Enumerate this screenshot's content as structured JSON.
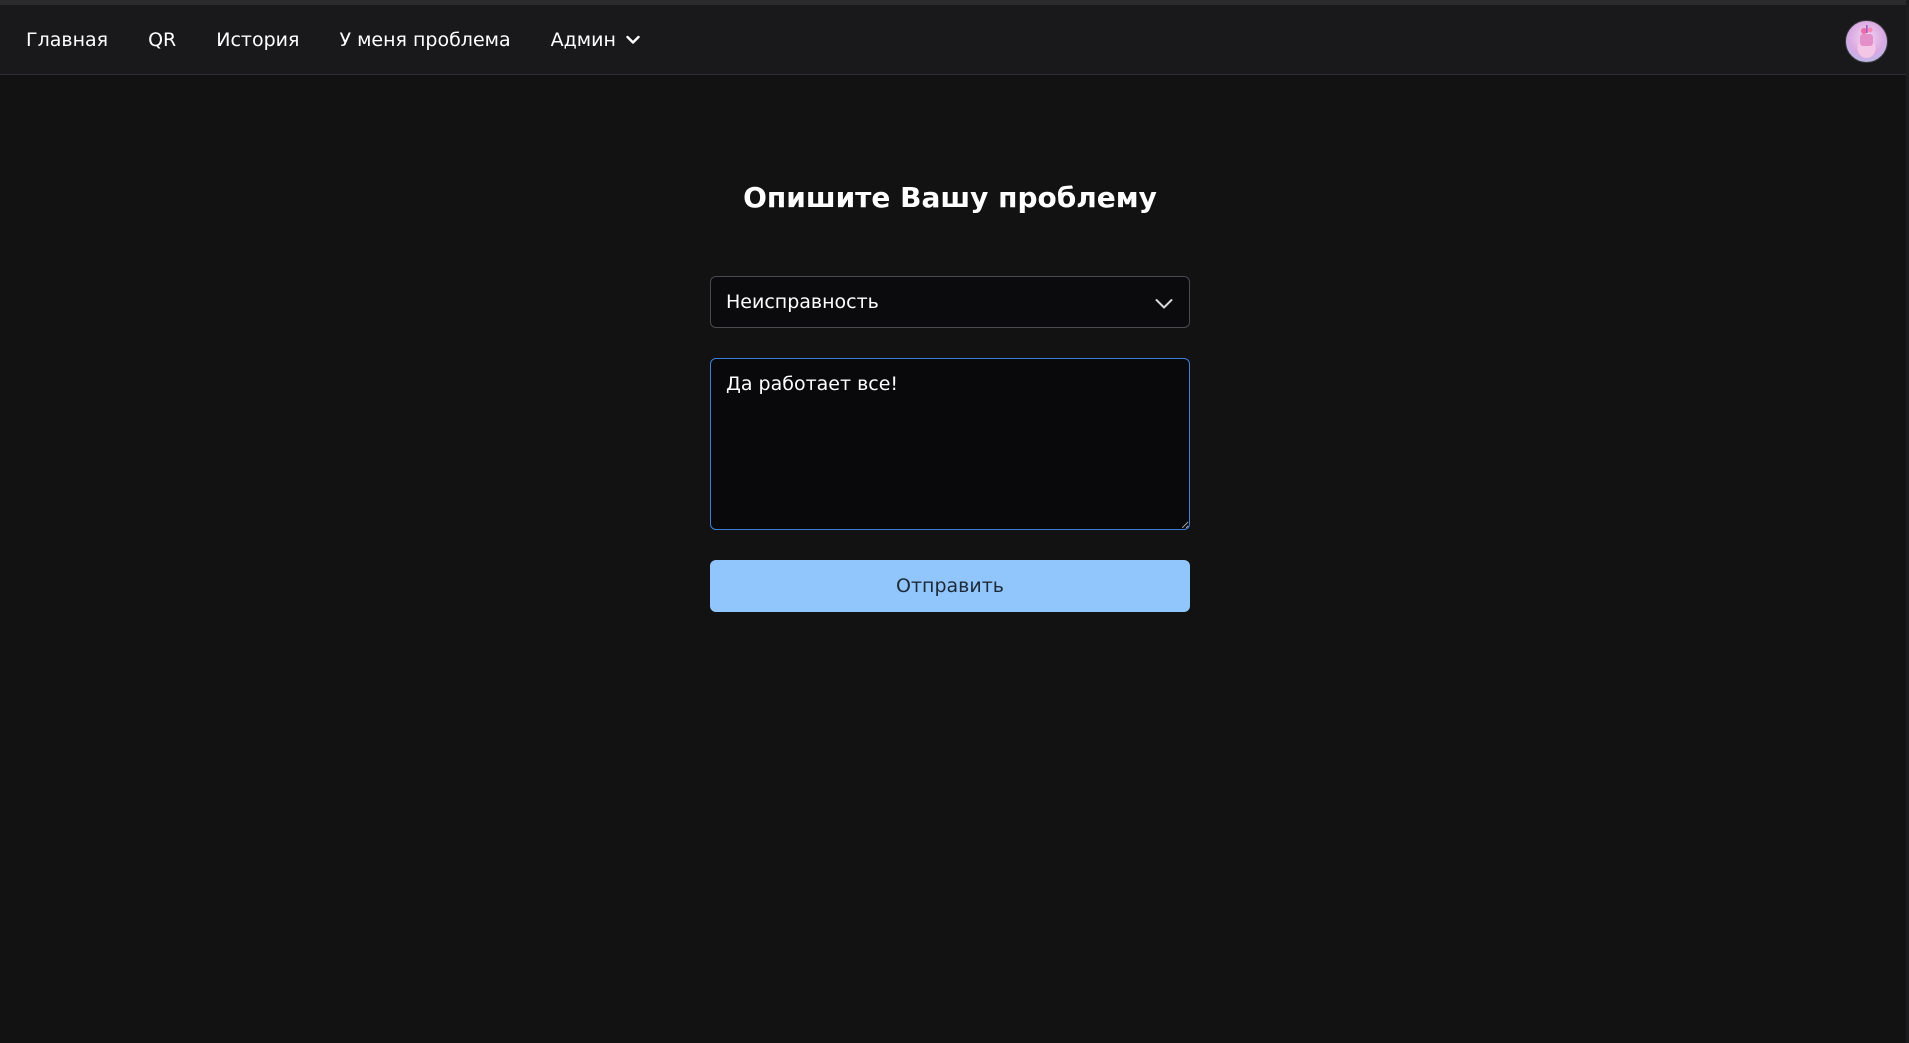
{
  "nav": {
    "items": [
      {
        "label": "Главная"
      },
      {
        "label": "QR"
      },
      {
        "label": "История"
      },
      {
        "label": "У меня проблема"
      },
      {
        "label": "Админ"
      }
    ],
    "avatar_icon": "user-avatar-icon"
  },
  "page": {
    "title": "Опишите Вашу проблему"
  },
  "form": {
    "category_value": "Неисправность",
    "description_value": "Да работает все!",
    "submit_label": "Отправить"
  },
  "colors": {
    "background": "#121212",
    "navbar": "#19191b",
    "accent_button": "#90c6fc",
    "focus_border": "#3f7fd9"
  }
}
